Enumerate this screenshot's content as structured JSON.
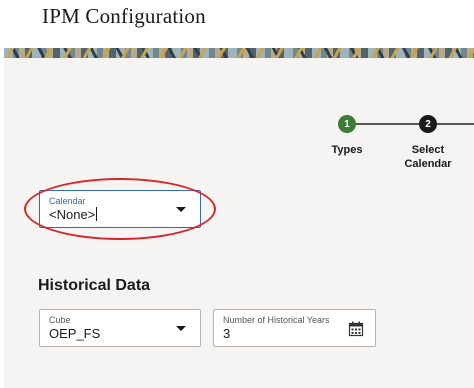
{
  "page": {
    "title": "IPM Configuration"
  },
  "train": {
    "steps": [
      {
        "number": "1",
        "label": "Types",
        "state": "completed"
      },
      {
        "number": "2",
        "label": "Select Calendar",
        "state": "current"
      }
    ]
  },
  "calendar_field": {
    "label": "Calendar",
    "value": "<None>"
  },
  "historical_data": {
    "heading": "Historical Data",
    "cube_field": {
      "label": "Cube",
      "value": "OEP_FS"
    },
    "years_field": {
      "label": "Number of Historical Years",
      "value": "3"
    }
  },
  "colors": {
    "completed_step": "#3c7c34",
    "current_step": "#1a1a1a",
    "focus_border": "#2e6db4",
    "annotation": "#d7262b",
    "panel_background": "#f5f4f2"
  },
  "icons": {
    "dropdown": "chevron-down-icon",
    "calendar": "calendar-icon"
  }
}
